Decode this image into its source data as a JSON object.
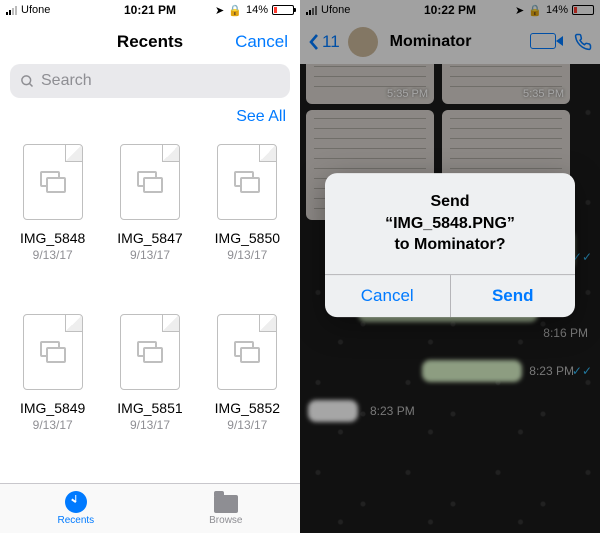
{
  "left": {
    "status": {
      "carrier": "Ufone",
      "time": "10:21 PM",
      "battery": "14%"
    },
    "nav": {
      "title": "Recents",
      "cancel": "Cancel"
    },
    "search": {
      "placeholder": "Search"
    },
    "see_all": "See All",
    "files": [
      {
        "name": "IMG_5848",
        "date": "9/13/17"
      },
      {
        "name": "IMG_5847",
        "date": "9/13/17"
      },
      {
        "name": "IMG_5850",
        "date": "9/13/17"
      },
      {
        "name": "IMG_5849",
        "date": "9/13/17"
      },
      {
        "name": "IMG_5851",
        "date": "9/13/17"
      },
      {
        "name": "IMG_5852",
        "date": "9/13/17"
      }
    ],
    "tabs": {
      "recents": "Recents",
      "browse": "Browse"
    }
  },
  "right": {
    "status": {
      "carrier": "Ufone",
      "time": "10:22 PM",
      "battery": "14%"
    },
    "back_count": "11",
    "contact": "Mominator",
    "img_time": "5:35 PM",
    "ts1": "8:16 PM",
    "ts2": "8:23 PM",
    "ts3": "8:23 PM",
    "alert": {
      "line1": "Send",
      "line2": "“IMG_5848.PNG”",
      "line3": "to Mominator?",
      "cancel": "Cancel",
      "send": "Send"
    }
  }
}
